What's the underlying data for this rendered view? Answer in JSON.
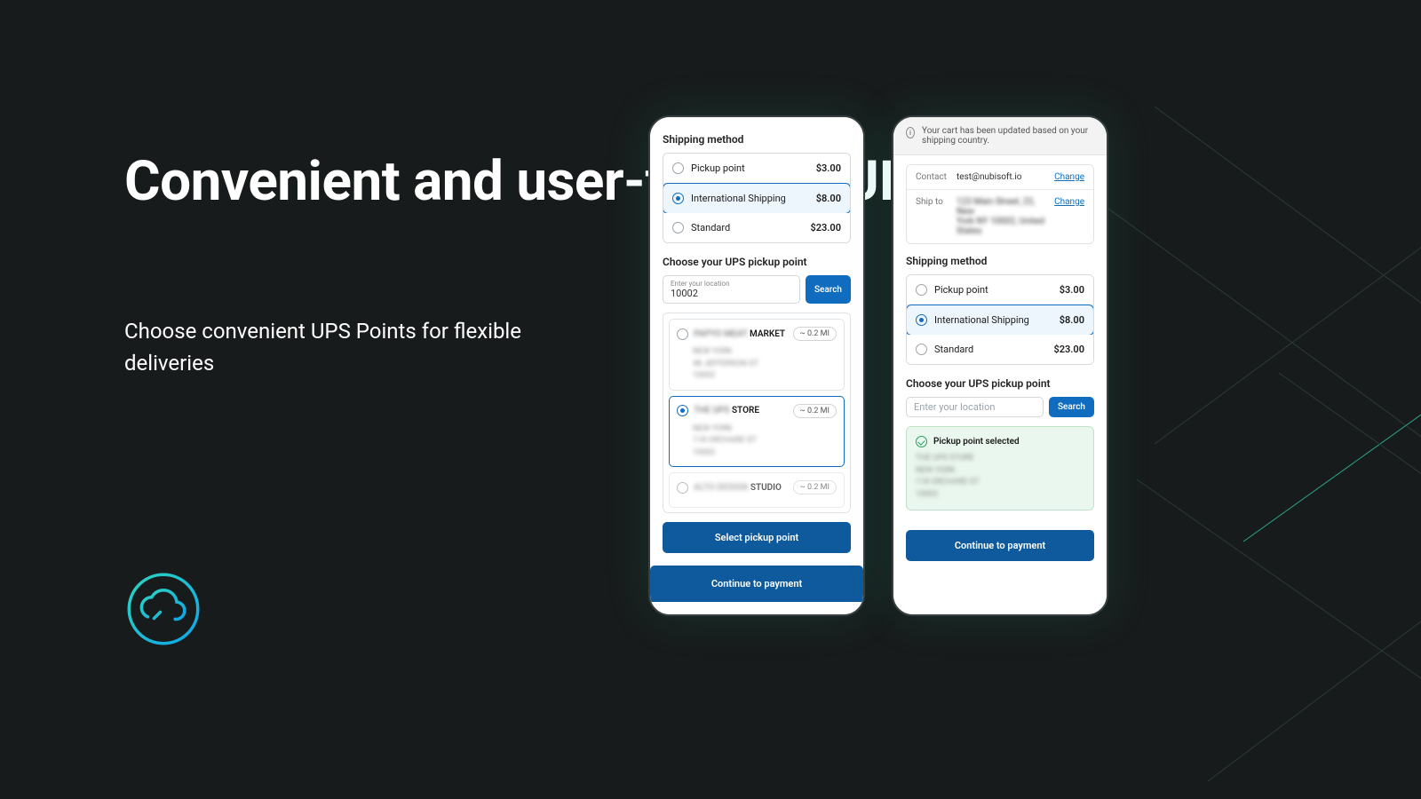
{
  "headline": "Convenient and user-friendly UI",
  "subhead": "Choose convenient UPS Points for flexible deliveries",
  "phone1": {
    "shipping_title": "Shipping method",
    "options": [
      {
        "label": "Pickup point",
        "price": "$3.00",
        "selected": false
      },
      {
        "label": "International Shipping",
        "price": "$8.00",
        "selected": true
      },
      {
        "label": "Standard",
        "price": "$23.00",
        "selected": false
      }
    ],
    "pickup_title": "Choose your UPS pickup point",
    "search_label": "Enter your location",
    "search_value": "10002",
    "search_btn": "Search",
    "results": [
      {
        "name_suffix": "MARKET",
        "distance": "~ 0.2 MI",
        "selected": false
      },
      {
        "name_suffix": "STORE",
        "distance": "~ 0.2 MI",
        "selected": true
      },
      {
        "name_suffix": "STUDIO",
        "distance": "~ 0.2 MI",
        "selected": false
      }
    ],
    "select_btn": "Select pickup point",
    "continue_btn": "Continue to payment"
  },
  "phone2": {
    "banner_text": "Your cart has been updated based on your shipping country.",
    "contact_label": "Contact",
    "contact_value": "test@nubisoft.io",
    "shipto_label": "Ship to",
    "change": "Change",
    "shipping_title": "Shipping method",
    "options": [
      {
        "label": "Pickup point",
        "price": "$3.00",
        "selected": false
      },
      {
        "label": "International Shipping",
        "price": "$8.00",
        "selected": true
      },
      {
        "label": "Standard",
        "price": "$23.00",
        "selected": false
      }
    ],
    "pickup_title": "Choose your UPS pickup point",
    "search_placeholder": "Enter your location",
    "search_btn": "Search",
    "selected_label": "Pickup point selected",
    "continue_btn": "Continue to payment"
  }
}
